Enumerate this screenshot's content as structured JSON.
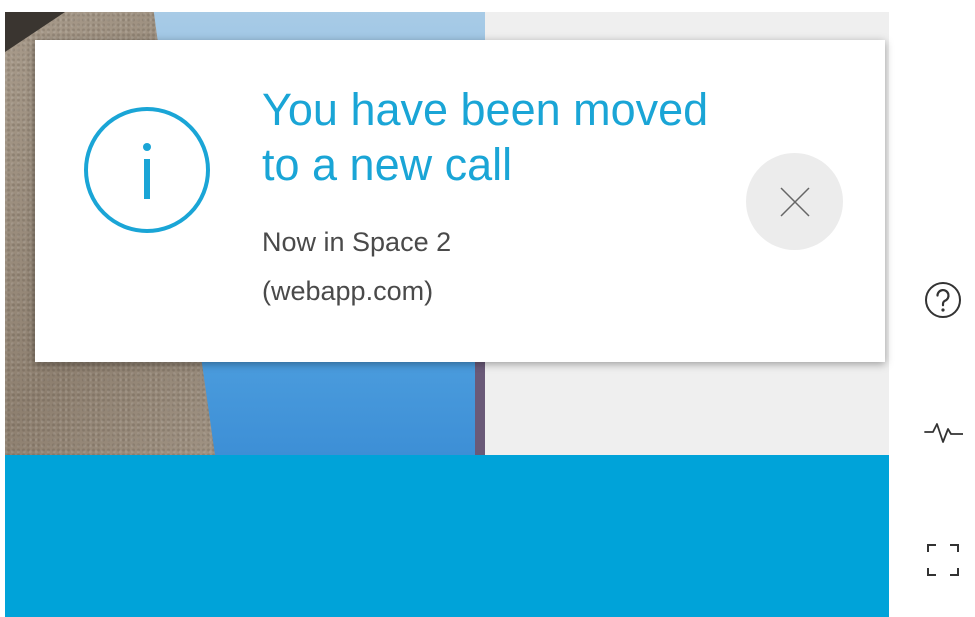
{
  "notification": {
    "title": "You have been moved to a new call",
    "subtitle_line1": "Now in Space 2",
    "subtitle_line2": "(webapp.com)",
    "icon": "info-icon",
    "close_icon": "close-icon",
    "accent_color": "#1aa5d6"
  },
  "side_controls": [
    {
      "icon": "help-icon"
    },
    {
      "icon": "activity-icon"
    },
    {
      "icon": "fullscreen-icon"
    }
  ],
  "colors": {
    "bottom_bar": "#00a3d9",
    "stage_background": "#efefef"
  }
}
